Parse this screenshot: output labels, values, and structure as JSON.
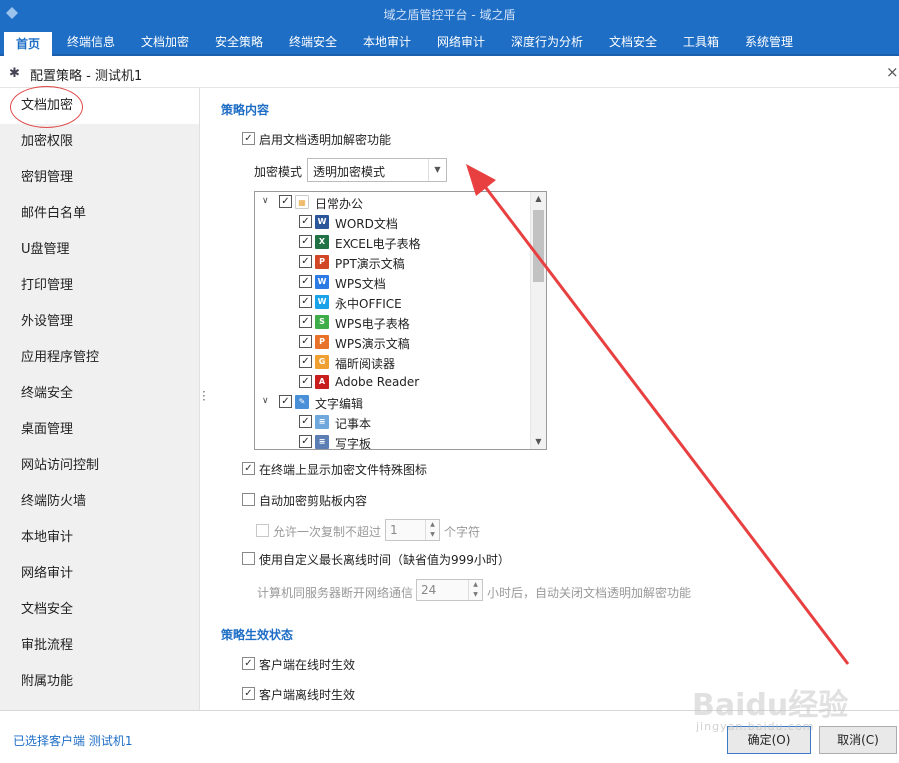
{
  "app": {
    "title": "域之盾管控平台 - 域之盾"
  },
  "menu": [
    {
      "label": "首页",
      "active": true
    },
    {
      "label": "终端信息"
    },
    {
      "label": "文档加密"
    },
    {
      "label": "安全策略"
    },
    {
      "label": "终端安全"
    },
    {
      "label": "本地审计"
    },
    {
      "label": "网络审计"
    },
    {
      "label": "深度行为分析"
    },
    {
      "label": "文档安全"
    },
    {
      "label": "工具箱"
    },
    {
      "label": "系统管理"
    }
  ],
  "dialog": {
    "title": "配置策略 - 测试机1",
    "close_glyph": "×"
  },
  "sidebar": [
    {
      "label": "文档加密",
      "active": true
    },
    {
      "label": "加密权限"
    },
    {
      "label": "密钥管理"
    },
    {
      "label": "邮件白名单"
    },
    {
      "label": "U盘管理"
    },
    {
      "label": "打印管理"
    },
    {
      "label": "外设管理"
    },
    {
      "label": "应用程序管控"
    },
    {
      "label": "终端安全"
    },
    {
      "label": "桌面管理"
    },
    {
      "label": "网站访问控制"
    },
    {
      "label": "终端防火墙"
    },
    {
      "label": "本地审计"
    },
    {
      "label": "网络审计"
    },
    {
      "label": "文档安全"
    },
    {
      "label": "审批流程"
    },
    {
      "label": "附属功能"
    }
  ],
  "content": {
    "section1_title": "策略内容",
    "enable_transparent": {
      "label": "启用文档透明加解密功能",
      "checked": true
    },
    "encrypt_mode": {
      "label": "加密模式",
      "value": "透明加密模式"
    },
    "tree": [
      {
        "label": "日常办公",
        "level": 0,
        "expanded": true,
        "checked": true,
        "icon": "office-group-icon",
        "color": "#e8a33a"
      },
      {
        "label": "WORD文档",
        "level": 1,
        "checked": true,
        "icon": "word-icon",
        "color": "#2b579a"
      },
      {
        "label": "EXCEL电子表格",
        "level": 1,
        "checked": true,
        "icon": "excel-icon",
        "color": "#217346"
      },
      {
        "label": "PPT演示文稿",
        "level": 1,
        "checked": true,
        "icon": "ppt-icon",
        "color": "#d24726"
      },
      {
        "label": "WPS文档",
        "level": 1,
        "checked": true,
        "icon": "wps-writer-icon",
        "color": "#2d7be5"
      },
      {
        "label": "永中OFFICE",
        "level": 1,
        "checked": true,
        "icon": "yozo-icon",
        "color": "#1aa3e8"
      },
      {
        "label": "WPS电子表格",
        "level": 1,
        "checked": true,
        "icon": "wps-sheet-icon",
        "color": "#3fae49"
      },
      {
        "label": "WPS演示文稿",
        "level": 1,
        "checked": true,
        "icon": "wps-ppt-icon",
        "color": "#e8722a"
      },
      {
        "label": "福昕阅读器",
        "level": 1,
        "checked": true,
        "icon": "foxit-icon",
        "color": "#f0a030"
      },
      {
        "label": "Adobe Reader",
        "level": 1,
        "checked": true,
        "icon": "adobe-reader-icon",
        "color": "#c81e1e"
      },
      {
        "label": "文字编辑",
        "level": 0,
        "expanded": true,
        "checked": true,
        "icon": "text-edit-group-icon",
        "color": "#4a90d9"
      },
      {
        "label": "记事本",
        "level": 1,
        "checked": true,
        "icon": "notepad-icon",
        "color": "#6fa8dc"
      },
      {
        "label": "写字板",
        "level": 1,
        "checked": true,
        "icon": "wordpad-icon",
        "color": "#5b7fb5"
      }
    ],
    "show_icon": {
      "label": "在终端上显示加密文件特殊图标",
      "checked": true
    },
    "clipboard": {
      "label": "自动加密剪贴板内容",
      "checked": false
    },
    "copy_limit": {
      "label": "允许一次复制不超过",
      "value": "1",
      "unit": "个字符",
      "checked": false
    },
    "offline": {
      "label": "使用自定义最长离线时间（缺省值为999小时）",
      "checked": false
    },
    "offline_detail": {
      "prefix": "计算机同服务器断开网络通信",
      "value": "24",
      "suffix": "小时后，自动关闭文档透明加解密功能"
    },
    "section2_title": "策略生效状态",
    "online_effect": {
      "label": "客户端在线时生效",
      "checked": true
    },
    "offline_effect": {
      "label": "客户端离线时生效",
      "checked": true
    }
  },
  "footer": {
    "status": "已选择客户端 测试机1",
    "ok": "确定(O)",
    "cancel": "取消(C)"
  },
  "watermark": {
    "text": "Baidu经验",
    "sub": "jingyan.baidu.com"
  },
  "colors": {
    "accent": "#1e6ec6",
    "annotation": "#e84040"
  }
}
